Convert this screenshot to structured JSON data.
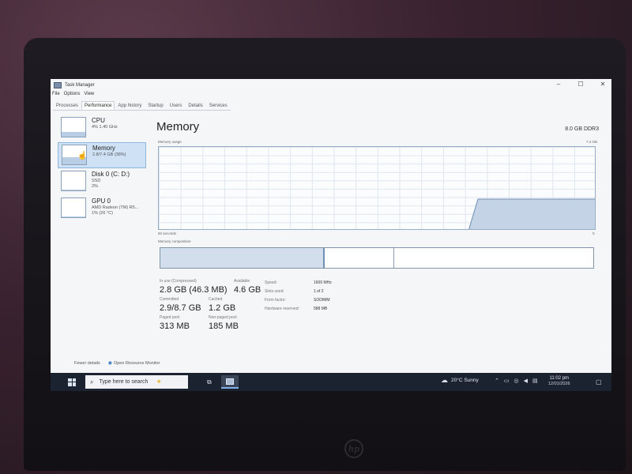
{
  "window": {
    "title": "Task Manager",
    "controls": {
      "minimize": "–",
      "maximize": "☐",
      "close": "✕"
    }
  },
  "menu": [
    "File",
    "Options",
    "View"
  ],
  "tabs": [
    {
      "label": "Processes",
      "active": false
    },
    {
      "label": "Performance",
      "active": true
    },
    {
      "label": "App history",
      "active": false
    },
    {
      "label": "Startup",
      "active": false
    },
    {
      "label": "Users",
      "active": false
    },
    {
      "label": "Details",
      "active": false
    },
    {
      "label": "Services",
      "active": false
    }
  ],
  "sidebar": {
    "items": [
      {
        "name": "CPU",
        "sub1": "4% 1.40 GHz",
        "sub2": "",
        "fill": 0.25
      },
      {
        "name": "Memory",
        "sub1": "2.8/7.4 GB (38%)",
        "sub2": "",
        "fill": 0.38,
        "selected": true
      },
      {
        "name": "Disk 0 (C: D:)",
        "sub1": "SSD",
        "sub2": "2%",
        "fill": 0.02
      },
      {
        "name": "GPU 0",
        "sub1": "AMD Radeon (TM) R5...",
        "sub2": "1% (26 °C)",
        "fill": 0.01
      }
    ]
  },
  "main": {
    "title": "Memory",
    "spec": "8.0 GB DDR3",
    "usage_label": "Memory usage",
    "usage_max": "7.4 GB",
    "time_left": "60 seconds",
    "time_right": "0",
    "composition_label": "Memory composition",
    "composition": [
      0.38,
      0.16,
      0.46
    ],
    "stats": {
      "in_use_label": "In use (Compressed)",
      "in_use": "2.8 GB (46.3 MB)",
      "available_label": "Available",
      "available": "4.6 GB",
      "committed_label": "Committed",
      "committed": "2.9/8.7 GB",
      "cached_label": "Cached",
      "cached": "1.2 GB",
      "paged_label": "Paged pool",
      "paged": "313 MB",
      "nonpaged_label": "Non-paged pool",
      "nonpaged": "185 MB"
    },
    "details": [
      {
        "k": "Speed:",
        "v": "1600 MHz"
      },
      {
        "k": "Slots used:",
        "v": "1 of 2"
      },
      {
        "k": "Form factor:",
        "v": "SODIMM"
      },
      {
        "k": "Hardware reserved:",
        "v": "588 MB"
      }
    ]
  },
  "footer": {
    "fewer_details": "Fewer details",
    "resource_monitor": "Open Resource Monitor"
  },
  "taskbar": {
    "search_placeholder": "Type here to search",
    "weather": "20°C  Sunny",
    "time": "11:02 pm",
    "date": "12/01/2026"
  },
  "colors": {
    "graph_line": "#6f8fb5",
    "graph_fill": "#c4d3e6",
    "selected_bg": "#cfe2f5",
    "taskbar_bg": "#1b2331"
  }
}
